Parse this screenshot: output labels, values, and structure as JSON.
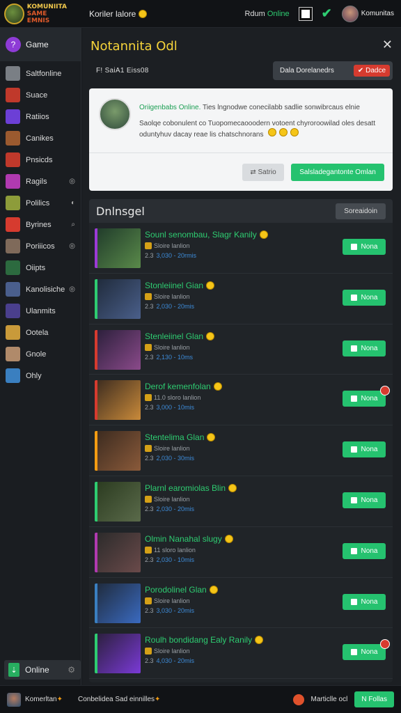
{
  "header": {
    "logo_line1": "KOMUNIITA",
    "logo_line2": "SAME EMNIS",
    "title": "Koriler lalore",
    "status_label": "Rdum",
    "status_value": "Online",
    "username": "Komunitas"
  },
  "sidebar": {
    "game_label": "Game",
    "items": [
      {
        "label": "Saltfonline",
        "color": "#7a7f85"
      },
      {
        "label": "Suace",
        "color": "#c0392b"
      },
      {
        "label": "Ratiios",
        "color": "#6c3fd6"
      },
      {
        "label": "Canikes",
        "color": "#9b5a2f"
      },
      {
        "label": "Pnsicds",
        "color": "#c0392b"
      },
      {
        "label": "Ragils",
        "color": "#b03ab0",
        "right": "◎"
      },
      {
        "label": "Polilics",
        "color": "#8d9c3a",
        "right": "◐"
      },
      {
        "label": "Byrines",
        "color": "#d63b2f",
        "right": "⌕"
      },
      {
        "label": "Poriiicos",
        "color": "#7f6a5a",
        "right": "◎"
      },
      {
        "label": "Oiipts",
        "color": "#2c6a3f"
      },
      {
        "label": "Kanolisiche",
        "color": "#4a5f8d",
        "right": "◎"
      },
      {
        "label": "Ulanmits",
        "color": "#4a3f8d"
      },
      {
        "label": "Ootela",
        "color": "#c99a3a"
      },
      {
        "label": "Gnole",
        "color": "#b08a6a"
      },
      {
        "label": "Ohly",
        "color": "#3a7fc0"
      }
    ],
    "online_label": "Online"
  },
  "main": {
    "title": "Notannita Odl",
    "sub_label": "F! SaiA1 Eiss08",
    "sub_button_label": "Dala Dorelanedrs",
    "sub_button_red": "Dadce"
  },
  "notice": {
    "name": "Oriigenbabs Online.",
    "head_text": "Ties lngnodwe conecilabb sadlie sonwibrcaus elnie",
    "body_text": "Saolqe cobonulent co Tuopomecaooodern votoent chyroroowilad oles desatt oduntyhuv dacay reae lis chatschnorans",
    "btn_gray": "Satrio",
    "btn_green": "Salsladegantonte Omlan"
  },
  "list": {
    "title": "Dnlnsgel",
    "header_button": "Soreaidoin",
    "rows": [
      {
        "title": "Sounl senombau, Slagr Kanily",
        "meta1": "Sloire lanlion",
        "meta_num": "2.3",
        "meta_blue": "3,030 - 20rmis",
        "btn": "Nona",
        "stripe": "#9b3ad6",
        "bg1": "#1f3a2a",
        "bg2": "#5a8a4a",
        "badge": false
      },
      {
        "title": "Stonleiinel Gian",
        "meta1": "Sloire lanlion",
        "meta_num": "2.3",
        "meta_blue": "2,030 - 20mis",
        "btn": "Nona",
        "stripe": "#2ecc71",
        "bg1": "#1f2a3a",
        "bg2": "#4a5f8a",
        "badge": false
      },
      {
        "title": "Stenleiinel Glan",
        "meta1": "Sloire lanlion",
        "meta_num": "2.3",
        "meta_blue": "2,130 - 10ms",
        "btn": "Nona",
        "stripe": "#d63b2f",
        "bg1": "#2a1f3a",
        "bg2": "#8a4a8a",
        "badge": false
      },
      {
        "title": "Derof kemenfolan",
        "meta1": "11.0 sloro lanlion",
        "meta_num": "2.3",
        "meta_blue": "3,000 - 10mis",
        "btn": "Nona",
        "stripe": "#d63b2f",
        "bg1": "#3a2a1f",
        "bg2": "#c98a3a",
        "badge": true
      },
      {
        "title": "Stentelima Glan",
        "meta1": "Sloire lanlion",
        "meta_num": "2.3",
        "meta_blue": "2,030 - 30mis",
        "btn": "Nona",
        "stripe": "#f39c12",
        "bg1": "#3a2a1f",
        "bg2": "#8a5a3a",
        "badge": false
      },
      {
        "title": "Plarnl earomiolas Blin",
        "meta1": "Sloire lanlion",
        "meta_num": "2.3",
        "meta_blue": "2,030 - 20mis",
        "btn": "Nona",
        "stripe": "#2ecc71",
        "bg1": "#2a3a1f",
        "bg2": "#5a6a4a",
        "badge": false
      },
      {
        "title": "Olmin Nanahal slugy",
        "meta1": "11 sloro lanlion",
        "meta_num": "2.3",
        "meta_blue": "2,030 - 10mis",
        "btn": "Nona",
        "stripe": "#b03ab0",
        "bg1": "#2a2a2a",
        "bg2": "#6a4a4a",
        "badge": false
      },
      {
        "title": "Porodolinel Glan",
        "meta1": "Sloire lanlion",
        "meta_num": "2.3",
        "meta_blue": "3,030 - 20mis",
        "btn": "Nona",
        "stripe": "#3a7fc0",
        "bg1": "#1f2a3a",
        "bg2": "#3a6ac0",
        "badge": false
      },
      {
        "title": "Roulh bondidang Ealy Ranily",
        "meta1": "Sloire lanlion",
        "meta_num": "2.3",
        "meta_blue": "4,030 - 20mis",
        "btn": "Nona",
        "stripe": "#2ecc71",
        "bg1": "#2a1f3a",
        "bg2": "#7a3ad6",
        "badge": true
      }
    ]
  },
  "footer": {
    "user": "Komerltan",
    "message": "Conbelidea Sad einnilles",
    "right_label": "Marticlle ocl",
    "right_button": "N Follas"
  }
}
